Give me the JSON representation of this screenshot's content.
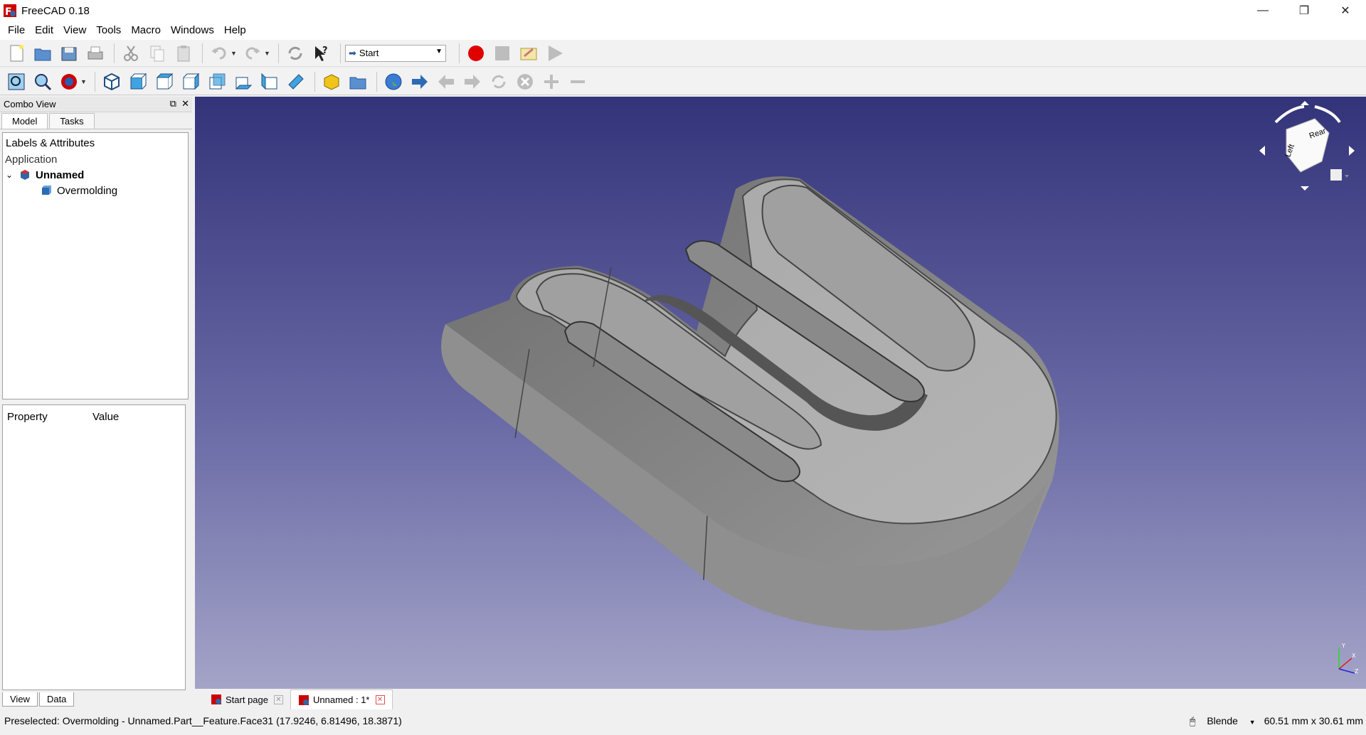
{
  "window": {
    "title": "FreeCAD 0.18",
    "minimize": "—",
    "restore": "❐",
    "close": "✕"
  },
  "menu": [
    "File",
    "Edit",
    "View",
    "Tools",
    "Macro",
    "Windows",
    "Help"
  ],
  "workbench": {
    "selected": "Start"
  },
  "combo_view": {
    "title": "Combo View",
    "tabs": [
      "Model",
      "Tasks"
    ],
    "tree_title": "Labels & Attributes",
    "section": "Application",
    "document": "Unnamed",
    "object": "Overmolding",
    "property_header": [
      "Property",
      "Value"
    ],
    "bottom_tabs": [
      "View",
      "Data"
    ]
  },
  "doc_tabs": [
    {
      "label": "Start page",
      "active": false
    },
    {
      "label": "Unnamed : 1*",
      "active": true
    }
  ],
  "navcube": {
    "face_top": "Rear",
    "face_left": "Left"
  },
  "status": {
    "message": "Preselected: Overmolding - Unnamed.Part__Feature.Face31 (17.9246, 6.81496, 18.3871)",
    "nav_style": "Blende",
    "dimensions": "60.51 mm x 30.61 mm"
  },
  "colors": {
    "viewport_top": "#33337a",
    "viewport_bottom": "#a4a4c8",
    "record": "#e00000"
  }
}
